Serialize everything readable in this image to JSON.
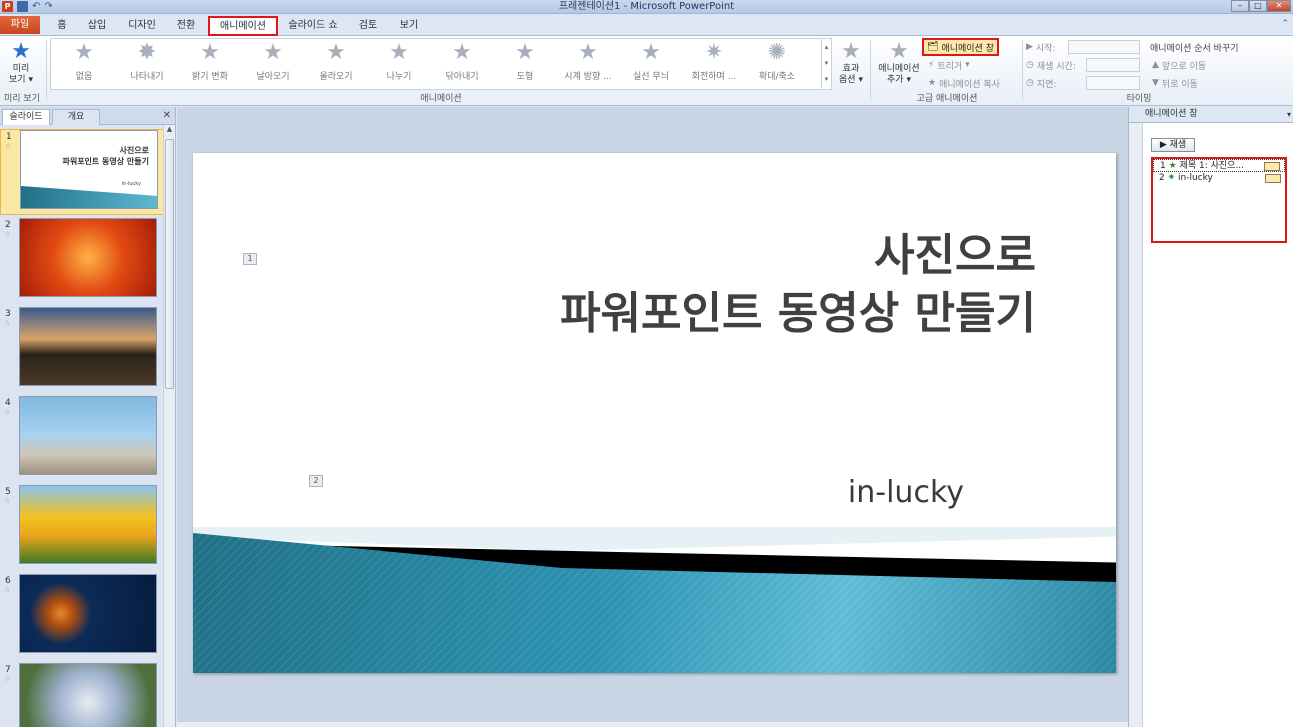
{
  "window": {
    "title": "프레젠테이션1 - Microsoft PowerPoint",
    "controls": [
      "–",
      "□",
      "✕"
    ]
  },
  "tabs": {
    "file": "파일",
    "items": [
      "홈",
      "삽입",
      "디자인",
      "전환",
      "애니메이션",
      "슬라이드 쇼",
      "검토",
      "보기"
    ],
    "active": "애니메이션"
  },
  "ribbon": {
    "preview": {
      "label1": "미리",
      "label2": "보기",
      "group": "미리 보기"
    },
    "animation_group_label": "애니메이션",
    "animations": [
      "없음",
      "나타내기",
      "밝기 변화",
      "날아오기",
      "올라오기",
      "나누기",
      "닦아내기",
      "도형",
      "시계 방향 ...",
      "실선 무늬",
      "회전하며 ...",
      "확대/축소"
    ],
    "effect_options": {
      "label1": "효과",
      "label2": "옵션"
    },
    "advanced": {
      "add_animation1": "애니메이션",
      "add_animation2": "추가",
      "animation_pane": "애니메이션 창",
      "trigger": "트리거",
      "painter": "애니메이션 복사",
      "group": "고급 애니메이션"
    },
    "timing": {
      "start": "시작:",
      "duration": "재생 시간:",
      "delay": "지연:",
      "reorder": "애니메이션 순서 바꾸기",
      "move_earlier": "앞으로 이동",
      "move_later": "뒤로 이동",
      "group": "타이밍"
    }
  },
  "left_pane": {
    "tabs": [
      "슬라이드",
      "개요"
    ],
    "slides": [
      {
        "num": "1",
        "type": "title"
      },
      {
        "num": "2",
        "type": "photo"
      },
      {
        "num": "3",
        "type": "photo"
      },
      {
        "num": "4",
        "type": "photo"
      },
      {
        "num": "5",
        "type": "photo"
      },
      {
        "num": "6",
        "type": "photo"
      },
      {
        "num": "7",
        "type": "photo"
      }
    ],
    "thumb1": {
      "title1": "사진으로",
      "title2": "파워포인트 동영상 만들기",
      "sub": "in-lucky"
    }
  },
  "slide": {
    "title_line1": "사진으로",
    "title_line2": "파워포인트 동영상 만들기",
    "subtitle": "in-lucky",
    "marker1": "1",
    "marker2": "2"
  },
  "animation_pane": {
    "header": "애니메이션 창",
    "play": "▶ 재생",
    "items": [
      {
        "num": "1",
        "label": "제목 1: 사진으..."
      },
      {
        "num": "2",
        "label": "in-lucky"
      }
    ]
  },
  "colors": {
    "highlight": "#e0161b",
    "file_tab": "#c8461d",
    "accent_teal": "#2b93b1"
  }
}
